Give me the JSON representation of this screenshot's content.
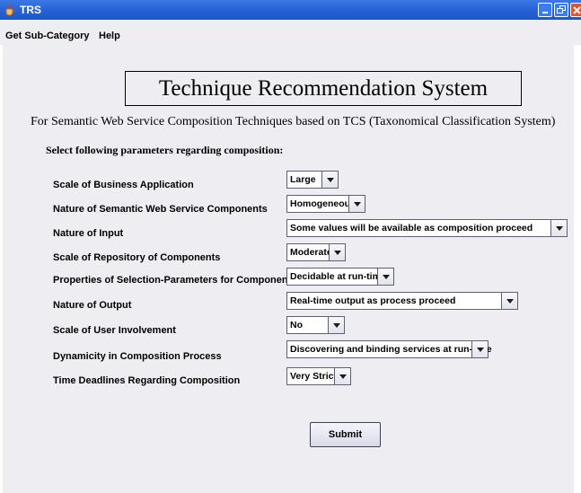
{
  "window": {
    "title": "TRS"
  },
  "menu": [
    {
      "label": "Get Sub-Category"
    },
    {
      "label": "Help"
    }
  ],
  "header": {
    "title": "Technique Recommendation System",
    "subtitle": "For Semantic Web Service Composition Techniques based on TCS (Taxonomical Classification System)",
    "instructions": "Select following parameters regarding composition:"
  },
  "parameters": [
    {
      "label": "Scale of Business Application",
      "value": "Large"
    },
    {
      "label": "Nature of Semantic Web Service Components",
      "value": "Homogeneous"
    },
    {
      "label": "Nature of Input",
      "value": "Some values will be available as composition proceed"
    },
    {
      "label": "Scale of Repository of Components",
      "value": "Moderate"
    },
    {
      "label": "Properties of Selection-Parameters for Components",
      "value": "Decidable at run-time"
    },
    {
      "label": "Nature of Output",
      "value": "Real-time output as process proceed"
    },
    {
      "label": "Scale of User Involvement",
      "value": "No"
    },
    {
      "label": "Dynamicity in Composition Process",
      "value": "Discovering and binding services at run-time"
    },
    {
      "label": "Time Deadlines Regarding Composition",
      "value": "Very Strict"
    }
  ],
  "actions": {
    "submit_label": "Submit"
  },
  "colors": {
    "titlebar": "#2a64d8",
    "panel": "#eeeef2",
    "close_button": "#e4522f"
  }
}
